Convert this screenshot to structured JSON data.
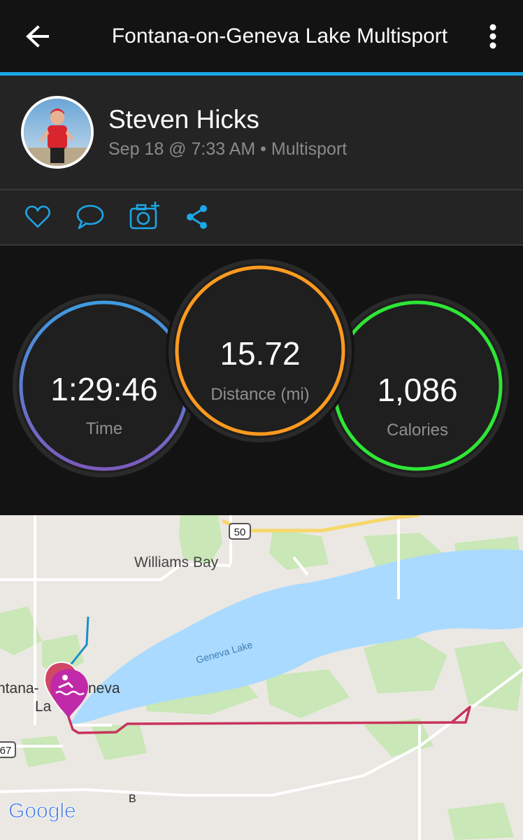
{
  "app": {
    "title": "Fontana-on-Geneva Lake Multisport",
    "accent_color": "#1ca7e6",
    "icons": [
      "back-arrow-icon",
      "more-vert-icon"
    ]
  },
  "activity": {
    "user_name": "Steven Hicks",
    "meta": "Sep 18 @ 7:33 AM • Multisport",
    "actions": [
      "heart-icon",
      "comment-icon",
      "add-photo-icon",
      "share-icon"
    ]
  },
  "stats": {
    "time": {
      "value": "1:29:46",
      "label": "Time"
    },
    "distance": {
      "value": "15.72",
      "label": "Distance (mi)"
    },
    "calories": {
      "value": "1,086",
      "label": "Calories"
    },
    "colors": {
      "time_top": "#3f9be0",
      "time_bottom": "#7c5bbd",
      "distance": "#ff9a1f",
      "calories": "#2ee636"
    }
  },
  "map": {
    "labels": {
      "williams_bay": "Williams Bay",
      "geneva_lake": "Geneva Lake",
      "fontana_line1": "ntana-",
      "fontana_line2": "neva",
      "fontana_line3": "La",
      "route_50": "50",
      "route_67": "67",
      "route_b": "B",
      "google": "Google"
    },
    "colors": {
      "water": "#aadaff",
      "land": "#ebe8e3",
      "park": "#c9e7b7",
      "route": "#c8335a",
      "marker": "#c02aa8"
    }
  }
}
